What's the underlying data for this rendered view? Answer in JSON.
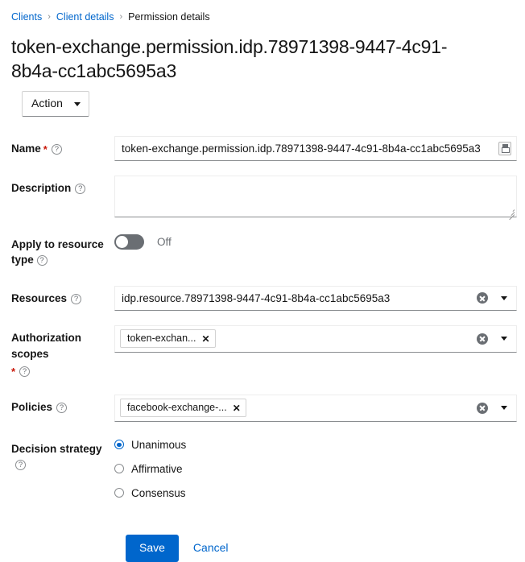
{
  "breadcrumb": {
    "items": [
      {
        "label": "Clients",
        "link": true
      },
      {
        "label": "Client details",
        "link": true
      },
      {
        "label": "Permission details",
        "link": false
      }
    ],
    "separator": "›"
  },
  "header": {
    "title": "token-exchange.permission.idp.78971398-9447-4c91-8b4a-cc1abc5695a3",
    "action_button": "Action"
  },
  "form": {
    "name": {
      "label": "Name",
      "required_marker": "*",
      "help": "?",
      "value": "token-exchange.permission.idp.78971398-9447-4c91-8b4a-cc1abc5695a3",
      "placeholder": ""
    },
    "description": {
      "label": "Description",
      "help": "?",
      "value": "",
      "placeholder": ""
    },
    "apply_to_resource_type": {
      "label": "Apply to resource type",
      "help": "?",
      "state_label": "Off",
      "checked": false
    },
    "resources": {
      "label": "Resources",
      "help": "?",
      "value": "idp.resource.78971398-9447-4c91-8b4a-cc1abc5695a3",
      "clear_icon": "times-circle-icon",
      "toggle_icon": "caret-down-icon"
    },
    "authorization_scopes": {
      "label": "Authorization scopes",
      "required_marker": "*",
      "help": "?",
      "chips": [
        {
          "label": "token-exchan...",
          "remove": "✕"
        }
      ],
      "clear_icon": "times-circle-icon",
      "toggle_icon": "caret-down-icon"
    },
    "policies": {
      "label": "Policies",
      "help": "?",
      "chips": [
        {
          "label": "facebook-exchange-...",
          "remove": "✕"
        }
      ],
      "clear_icon": "times-circle-icon",
      "toggle_icon": "caret-down-icon"
    },
    "decision_strategy": {
      "label": "Decision strategy",
      "help": "?",
      "options": [
        {
          "label": "Unanimous",
          "selected": true
        },
        {
          "label": "Affirmative",
          "selected": false
        },
        {
          "label": "Consensus",
          "selected": false
        }
      ]
    }
  },
  "footer": {
    "save_label": "Save",
    "cancel_label": "Cancel"
  },
  "colors": {
    "link": "#0066cc",
    "primary": "#0066cc",
    "required": "#c9190b",
    "muted": "#6a6e73",
    "text": "#151515"
  }
}
